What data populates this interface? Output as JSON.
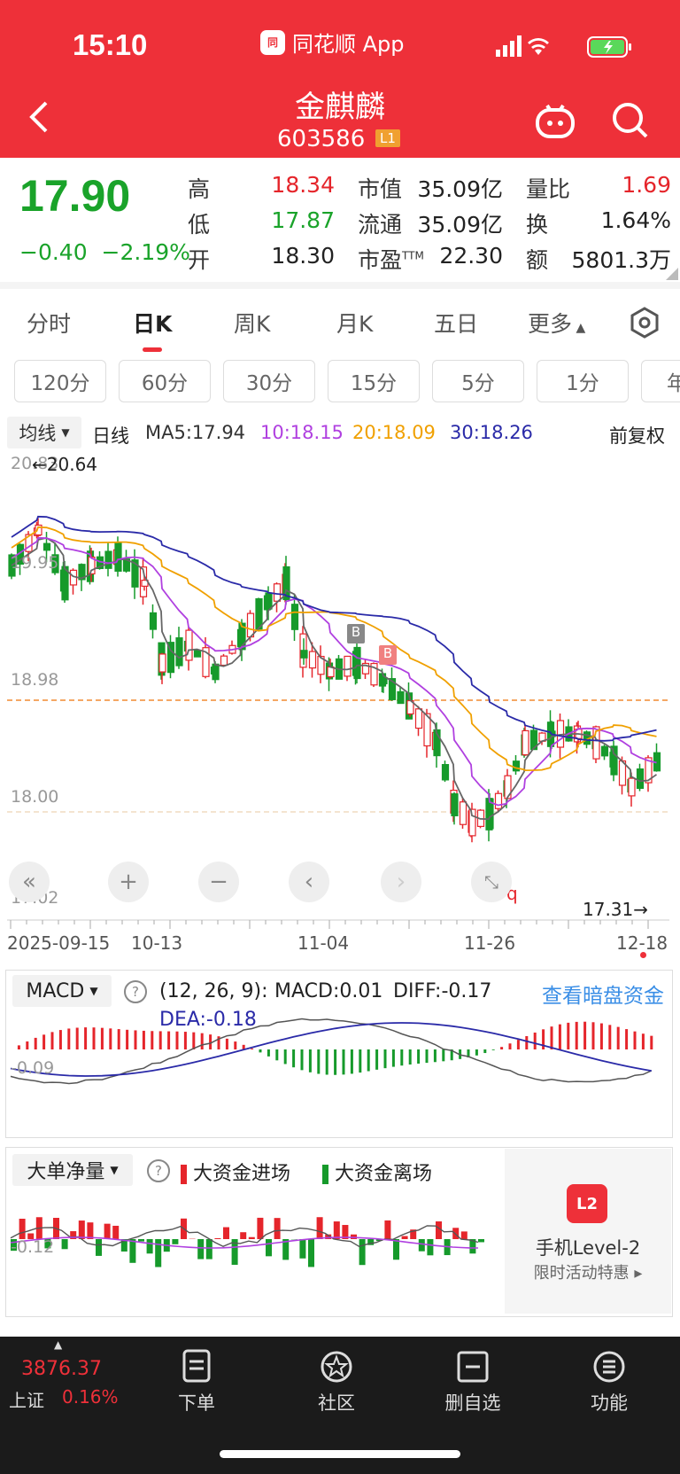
{
  "status_bar": {
    "time": "15:10",
    "app_name": "同花顺 App"
  },
  "header": {
    "stock_name": "金麒麟",
    "stock_code": "603586",
    "level_badge": "L1"
  },
  "quote": {
    "price": "17.90",
    "change": "−0.40",
    "change_pct": "−2.19%",
    "fields": [
      {
        "label": "高",
        "value": "18.34"
      },
      {
        "label": "低",
        "value": "17.87"
      },
      {
        "label": "开",
        "value": "18.30"
      },
      {
        "label": "市值",
        "value": "35.09亿"
      },
      {
        "label": "流通",
        "value": "35.09亿"
      },
      {
        "label": "市盈",
        "sup": "TTM",
        "value": "22.30"
      },
      {
        "label": "量比",
        "value": "1.69"
      },
      {
        "label": "换",
        "value": "1.64%"
      },
      {
        "label": "额",
        "value": "5801.3万"
      }
    ]
  },
  "tabs": [
    "分时",
    "日K",
    "周K",
    "月K",
    "五日",
    "更多"
  ],
  "active_tab": "日K",
  "intervals": [
    "120分",
    "60分",
    "30分",
    "15分",
    "5分",
    "1分",
    "年"
  ],
  "ma_bar": {
    "select": "均线",
    "period": "日线",
    "ma5": "MA5:17.94",
    "ma10": "10:18.15",
    "ma20": "20:18.09",
    "ma30": "30:18.26",
    "adjust": "前复权"
  },
  "kline": {
    "y_labels": [
      "20.83",
      "19.95",
      "18.98",
      "18.00",
      "17.02"
    ],
    "max_marker": "←20.64",
    "min_marker": "17.31→",
    "x_labels": [
      "2025-09-15",
      "10-13",
      "11-04",
      "11-26",
      "12-18"
    ],
    "signal_b": "B",
    "signal_b2": "B",
    "signal_q": "q",
    "colors": {
      "up": "#e5252b",
      "down": "#169a2b",
      "ma5": "#666666",
      "ma10": "#b040e0",
      "ma20": "#f0a000",
      "ma30": "#2a2aa8"
    }
  },
  "macd": {
    "select": "MACD",
    "params": "(12, 26, 9):",
    "macd": "MACD:0.01",
    "diff": "DIFF:-0.17",
    "dea": "DEA:-0.18",
    "link": "查看暗盘资金",
    "y_label": "-0.09"
  },
  "big_order": {
    "select": "大单净量",
    "in_label": "大资金进场",
    "out_label": "大资金离场",
    "y_label": "-0.12",
    "promo_title": "手机Level-2",
    "promo_sub": "限时活动特惠 ▸",
    "promo_icon": "L2"
  },
  "bottom_bar": {
    "index_value": "3876.37",
    "index_name": "上证",
    "index_pct": "0.16%",
    "items": [
      "下单",
      "社区",
      "删自选",
      "功能"
    ]
  }
}
